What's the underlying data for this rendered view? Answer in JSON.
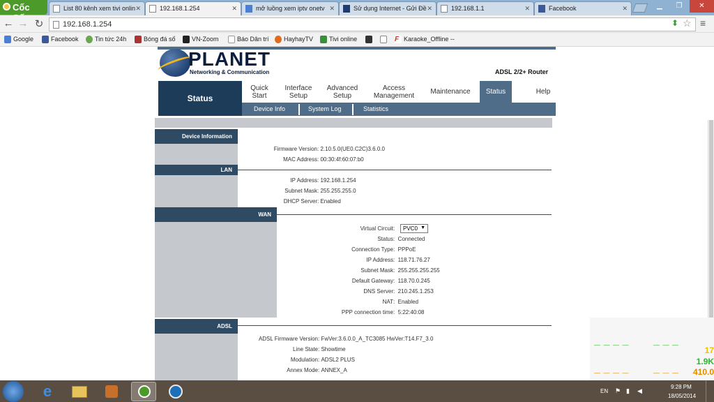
{
  "browser": {
    "logo": "Cốc Cốc",
    "tabs": [
      {
        "title": "List 80 kênh xem tivi onlin",
        "icon": "page-icon",
        "active": false
      },
      {
        "title": "192.168.1.254",
        "icon": "page-icon",
        "active": true
      },
      {
        "title": "mở luồng xem iptv onetv",
        "icon": "google-icon",
        "active": false
      },
      {
        "title": "Sử dụng Internet - Gửi Đề",
        "icon": "forum-icon",
        "active": false
      },
      {
        "title": "192.168.1.1",
        "icon": "page-icon",
        "active": false
      },
      {
        "title": "Facebook",
        "icon": "facebook-icon",
        "active": false
      }
    ],
    "address": "192.168.1.254",
    "bookmarks": [
      {
        "label": "Google",
        "color": "#4a7fd6"
      },
      {
        "label": "Facebook",
        "color": "#3b5998"
      },
      {
        "label": "Tin tức 24h",
        "color": "#6aa84f"
      },
      {
        "label": "Bóng đá số",
        "color": "#a33"
      },
      {
        "label": "VN-Zoom",
        "color": "#222"
      },
      {
        "label": "Báo Dân trí",
        "color": "#999"
      },
      {
        "label": "HayhayTV",
        "color": "#e06b1c"
      },
      {
        "label": "Tivi online",
        "color": "#3a8f3a"
      },
      {
        "label": "",
        "color": "#333"
      },
      {
        "label": "",
        "color": "#888"
      },
      {
        "label": "Karaoke_Offline --",
        "color": "#c0392b"
      }
    ]
  },
  "router": {
    "brand": "PLANET",
    "brand_sub": "Networking & Communication",
    "model": "ADSL 2/2+ Router",
    "current_menu": "Status",
    "menu": [
      {
        "label": "Quick Start"
      },
      {
        "label": "Interface Setup"
      },
      {
        "label": "Advanced Setup"
      },
      {
        "label": "Access Management"
      },
      {
        "label": "Maintenance"
      },
      {
        "label": "Status",
        "selected": true
      },
      {
        "label": "Help"
      }
    ],
    "submenu": [
      "Device Info",
      "System Log",
      "Statistics"
    ],
    "sections": {
      "device_info": {
        "title": "Device Information",
        "rows": [
          {
            "label": "Firmware Version",
            "value": "2.10.5.0(UE0.C2C)3.6.0.0"
          },
          {
            "label": "MAC Address",
            "value": "00:30:4f:60:07:b0"
          }
        ]
      },
      "lan": {
        "title": "LAN",
        "rows": [
          {
            "label": "IP Address",
            "value": "192.168.1.254"
          },
          {
            "label": "Subnet Mask",
            "value": "255.255.255.0"
          },
          {
            "label": "DHCP Server",
            "value": "Enabled"
          }
        ]
      },
      "wan": {
        "title": "WAN",
        "virtual_circuit_label": "Virtual Circuit",
        "virtual_circuit_value": "PVC0",
        "rows": [
          {
            "label": "Status",
            "value": "Connected"
          },
          {
            "label": "Connection Type",
            "value": "PPPoE"
          },
          {
            "label": "IP Address",
            "value": "118.71.76.27"
          },
          {
            "label": "Subnet Mask",
            "value": "255.255.255.255"
          },
          {
            "label": "Default Gateway",
            "value": "118.70.0.245"
          },
          {
            "label": "DNS Server",
            "value": "210.245.1.253"
          },
          {
            "label": "NAT",
            "value": "Enabled"
          },
          {
            "label": "PPP connection time",
            "value": "5:22:40:08"
          }
        ]
      },
      "adsl": {
        "title": "ADSL",
        "rows": [
          {
            "label": "ADSL Firmware Version",
            "value": "FwVer:3.6.0.0_A_TC3085 HwVer:T14.F7_3.0"
          },
          {
            "label": "Line State",
            "value": "Showtime"
          },
          {
            "label": "Modulation",
            "value": "ADSL2 PLUS"
          },
          {
            "label": "Annex Mode",
            "value": "ANNEX_A"
          }
        ]
      }
    }
  },
  "desktop_widget": {
    "values": [
      {
        "text": "17",
        "color": "#e8c300"
      },
      {
        "text": "1.9K",
        "color": "#2eb82e"
      },
      {
        "text": "410.0",
        "color": "#e08a00"
      }
    ]
  },
  "taskbar": {
    "language": "EN",
    "time": "9:28 PM",
    "date": "18/05/2014"
  }
}
